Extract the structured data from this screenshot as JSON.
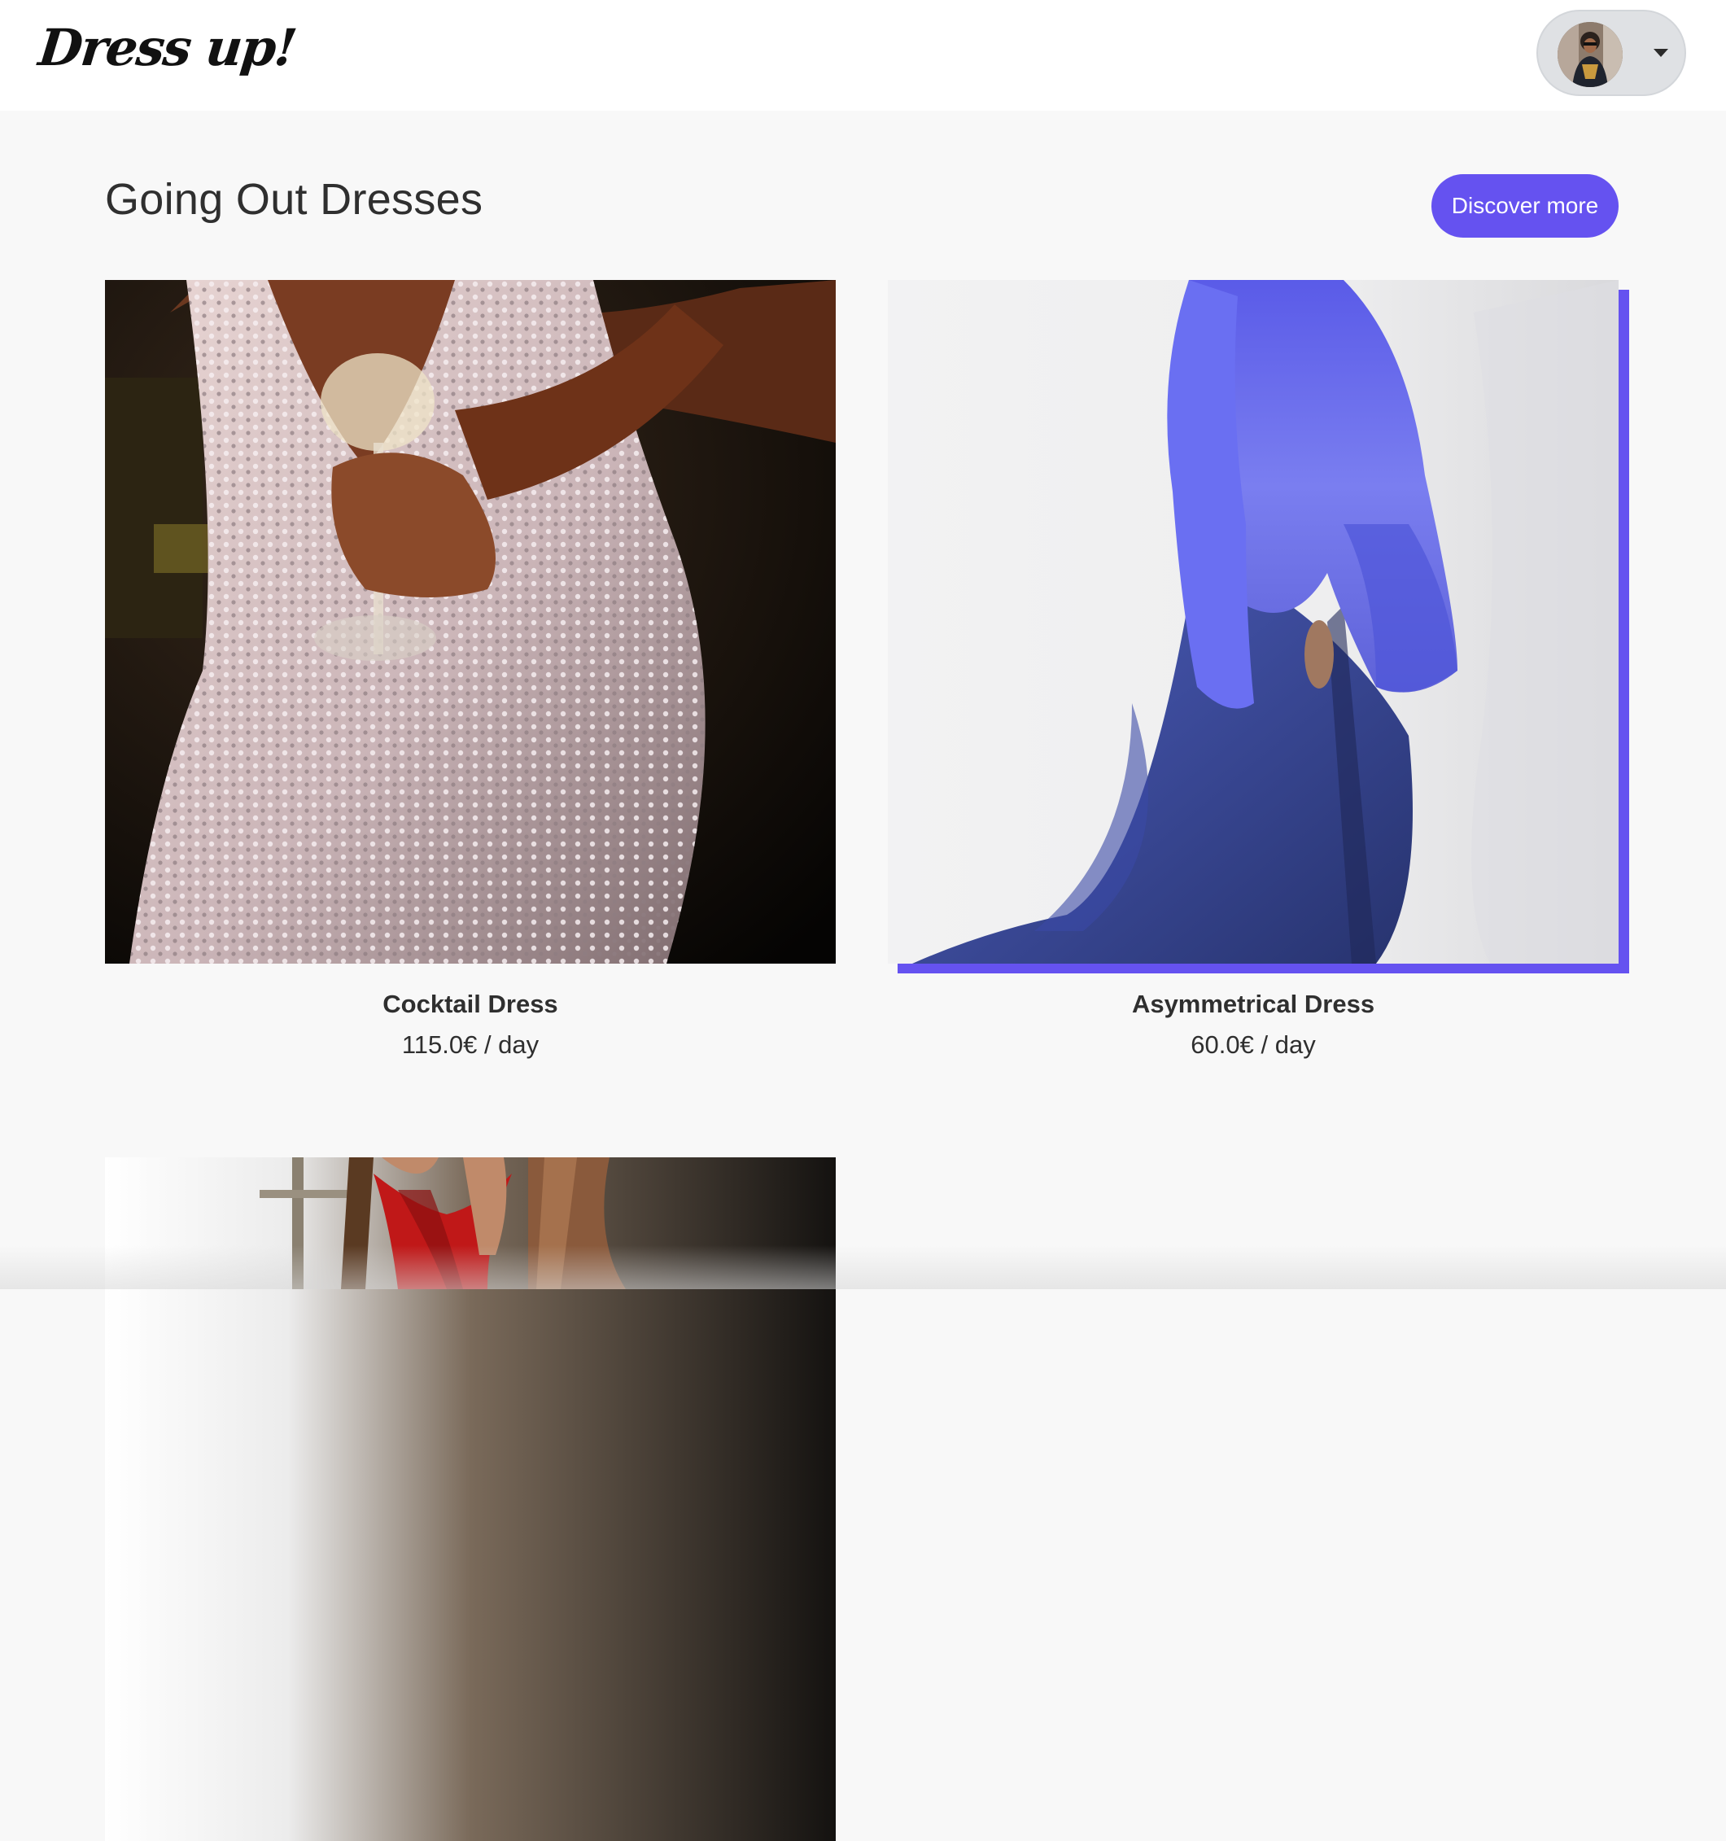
{
  "header": {
    "brand": "Dress up!",
    "user_menu": {
      "avatar_icon": "user-avatar-icon",
      "dropdown_icon": "caret-down-icon"
    }
  },
  "section": {
    "title": "Going Out Dresses",
    "discover_label": "Discover more"
  },
  "products": [
    {
      "name": "Cocktail Dress",
      "price": "115.0€ / day",
      "image": "sequin-dress-photo",
      "highlighted": false
    },
    {
      "name": "Asymmetrical Dress",
      "price": "60.0€ / day",
      "image": "blue-fur-coat-dress-photo",
      "highlighted": true
    },
    {
      "name": "",
      "price": "",
      "image": "red-dress-photo",
      "highlighted": false
    }
  ],
  "colors": {
    "accent": "#6552f0",
    "background": "#f8f8f8",
    "navbar": "#ffffff",
    "text": "#2f2f2f"
  }
}
